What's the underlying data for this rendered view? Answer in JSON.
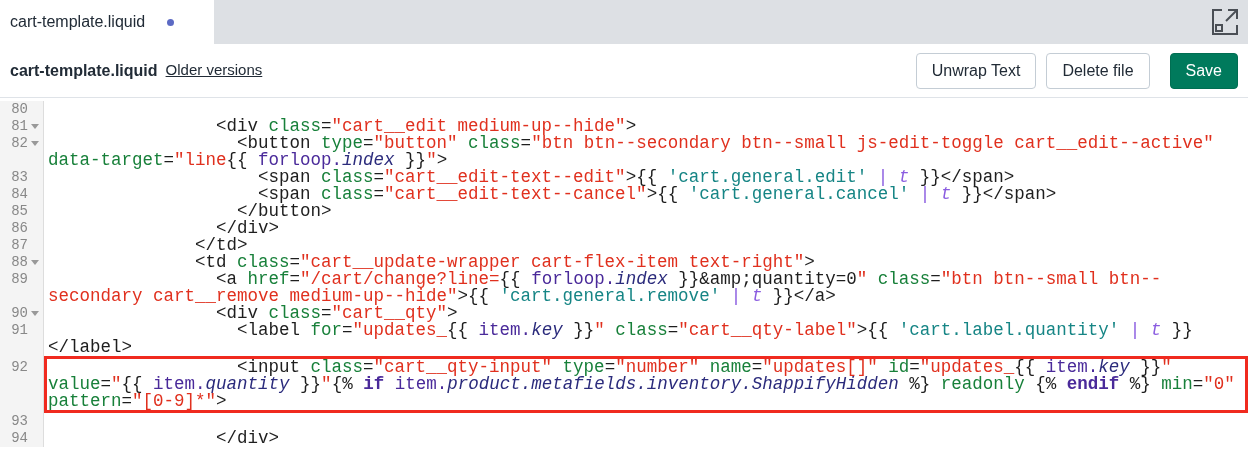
{
  "tab": {
    "label": "cart-template.liquid",
    "unsaved": true
  },
  "header": {
    "title": "cart-template.liquid",
    "link": "Older versions",
    "buttons": [
      {
        "label": "Unwrap Text",
        "kind": "secondary"
      },
      {
        "label": "Delete file",
        "kind": "secondary"
      },
      {
        "label": "Save",
        "kind": "primary"
      }
    ]
  },
  "lines": [
    {
      "number": "80",
      "foldable": false,
      "highlighted": false
    },
    {
      "number": "81",
      "foldable": true,
      "highlighted": false,
      "rows": [
        {
          "segments": [
            {
              "kind": "plain",
              "text": "                <div"
            },
            {
              "kind": "attr",
              "text": " class"
            },
            {
              "kind": "plain",
              "text": "="
            },
            {
              "kind": "string",
              "text": "\"cart__edit medium-up--hide\""
            },
            {
              "kind": "plain",
              "text": ">"
            }
          ]
        }
      ]
    },
    {
      "number": "82",
      "foldable": true,
      "highlighted": false,
      "rows": [
        {
          "segments": [
            {
              "kind": "plain",
              "text": "                  <button"
            },
            {
              "kind": "attr",
              "text": " type"
            },
            {
              "kind": "plain",
              "text": "="
            },
            {
              "kind": "string",
              "text": "\"button\""
            },
            {
              "kind": "attr",
              "text": " class"
            },
            {
              "kind": "plain",
              "text": "="
            },
            {
              "kind": "string",
              "text": "\"btn btn--secondary btn--small js-edit-toggle cart__edit--active\""
            }
          ]
        },
        {
          "segments": [
            {
              "kind": "attr",
              "text": "data-target"
            },
            {
              "kind": "plain",
              "text": "="
            },
            {
              "kind": "string",
              "text": "\"line"
            },
            {
              "kind": "plain",
              "text": "{{ "
            },
            {
              "kind": "var",
              "text": "forloop."
            },
            {
              "kind": "prop",
              "text": "index"
            },
            {
              "kind": "plain",
              "text": " }}"
            },
            {
              "kind": "string",
              "text": "\""
            },
            {
              "kind": "plain",
              "text": ">"
            }
          ]
        }
      ]
    },
    {
      "number": "83",
      "foldable": false,
      "highlighted": false,
      "rows": [
        {
          "segments": [
            {
              "kind": "plain",
              "text": "                    <span"
            },
            {
              "kind": "attr",
              "text": " class"
            },
            {
              "kind": "plain",
              "text": "="
            },
            {
              "kind": "string",
              "text": "\"cart__edit-text--edit\""
            },
            {
              "kind": "plain",
              "text": ">{{ "
            },
            {
              "kind": "lstring",
              "text": "'cart.general.edit'"
            },
            {
              "kind": "filter",
              "text": " | t"
            },
            {
              "kind": "plain",
              "text": " }}</span>"
            }
          ]
        }
      ]
    },
    {
      "number": "84",
      "foldable": false,
      "highlighted": false,
      "rows": [
        {
          "segments": [
            {
              "kind": "plain",
              "text": "                    <span"
            },
            {
              "kind": "attr",
              "text": " class"
            },
            {
              "kind": "plain",
              "text": "="
            },
            {
              "kind": "string",
              "text": "\"cart__edit-text--cancel\""
            },
            {
              "kind": "plain",
              "text": ">{{ "
            },
            {
              "kind": "lstring",
              "text": "'cart.general.cancel'"
            },
            {
              "kind": "filter",
              "text": " | t"
            },
            {
              "kind": "plain",
              "text": " }}</span>"
            }
          ]
        }
      ]
    },
    {
      "number": "85",
      "foldable": false,
      "highlighted": false,
      "rows": [
        {
          "segments": [
            {
              "kind": "plain",
              "text": "                  </button>"
            }
          ]
        }
      ]
    },
    {
      "number": "86",
      "foldable": false,
      "highlighted": false,
      "rows": [
        {
          "segments": [
            {
              "kind": "plain",
              "text": "                </div>"
            }
          ]
        }
      ]
    },
    {
      "number": "87",
      "foldable": false,
      "highlighted": false,
      "rows": [
        {
          "segments": [
            {
              "kind": "plain",
              "text": "              </td>"
            }
          ]
        }
      ]
    },
    {
      "number": "88",
      "foldable": true,
      "highlighted": false,
      "rows": [
        {
          "segments": [
            {
              "kind": "plain",
              "text": "              <td"
            },
            {
              "kind": "attr",
              "text": " class"
            },
            {
              "kind": "plain",
              "text": "="
            },
            {
              "kind": "string",
              "text": "\"cart__update-wrapper cart-flex-item text-right\""
            },
            {
              "kind": "plain",
              "text": ">"
            }
          ]
        }
      ]
    },
    {
      "number": "89",
      "foldable": false,
      "highlighted": false,
      "rows": [
        {
          "segments": [
            {
              "kind": "plain",
              "text": "                <a"
            },
            {
              "kind": "attr",
              "text": " href"
            },
            {
              "kind": "plain",
              "text": "="
            },
            {
              "kind": "string",
              "text": "\"/cart/change?line="
            },
            {
              "kind": "plain",
              "text": "{{ "
            },
            {
              "kind": "var",
              "text": "forloop."
            },
            {
              "kind": "prop",
              "text": "index"
            },
            {
              "kind": "plain",
              "text": " }}&amp;quantity=0"
            },
            {
              "kind": "string",
              "text": "\""
            },
            {
              "kind": "attr",
              "text": " class"
            },
            {
              "kind": "plain",
              "text": "="
            },
            {
              "kind": "string",
              "text": "\"btn btn--small btn--"
            }
          ]
        },
        {
          "segments": [
            {
              "kind": "string",
              "text": "secondary cart__remove medium-up--hide\""
            },
            {
              "kind": "plain",
              "text": ">{{ "
            },
            {
              "kind": "lstring",
              "text": "'cart.general.remove'"
            },
            {
              "kind": "filter",
              "text": " | t"
            },
            {
              "kind": "plain",
              "text": " }}</a>"
            }
          ]
        }
      ]
    },
    {
      "number": "90",
      "foldable": true,
      "highlighted": false,
      "rows": [
        {
          "segments": [
            {
              "kind": "plain",
              "text": "                <div"
            },
            {
              "kind": "attr",
              "text": " class"
            },
            {
              "kind": "plain",
              "text": "="
            },
            {
              "kind": "string",
              "text": "\"cart__qty\""
            },
            {
              "kind": "plain",
              "text": ">"
            }
          ]
        }
      ]
    },
    {
      "number": "91",
      "foldable": false,
      "highlighted": false,
      "rows": [
        {
          "segments": [
            {
              "kind": "plain",
              "text": "                  <label"
            },
            {
              "kind": "attr",
              "text": " for"
            },
            {
              "kind": "plain",
              "text": "="
            },
            {
              "kind": "string",
              "text": "\"updates_"
            },
            {
              "kind": "plain",
              "text": "{{ "
            },
            {
              "kind": "var",
              "text": "item."
            },
            {
              "kind": "prop",
              "text": "key"
            },
            {
              "kind": "plain",
              "text": " }}"
            },
            {
              "kind": "string",
              "text": "\""
            },
            {
              "kind": "attr",
              "text": " class"
            },
            {
              "kind": "plain",
              "text": "="
            },
            {
              "kind": "string",
              "text": "\"cart__qty-label\""
            },
            {
              "kind": "plain",
              "text": ">{{ "
            },
            {
              "kind": "lstring",
              "text": "'cart.label.quantity'"
            },
            {
              "kind": "filter",
              "text": " | t"
            },
            {
              "kind": "plain",
              "text": " }}"
            }
          ]
        },
        {
          "segments": [
            {
              "kind": "plain",
              "text": "</label>"
            }
          ]
        }
      ]
    },
    {
      "number": "92",
      "foldable": false,
      "highlighted": true,
      "rows": [
        {
          "segments": [
            {
              "kind": "plain",
              "text": "                  <input"
            },
            {
              "kind": "attr",
              "text": " class"
            },
            {
              "kind": "plain",
              "text": "="
            },
            {
              "kind": "string",
              "text": "\"cart__qty-input\""
            },
            {
              "kind": "attr",
              "text": " type"
            },
            {
              "kind": "plain",
              "text": "="
            },
            {
              "kind": "string",
              "text": "\"number\""
            },
            {
              "kind": "attr",
              "text": " name"
            },
            {
              "kind": "plain",
              "text": "="
            },
            {
              "kind": "string",
              "text": "\"updates[]\""
            },
            {
              "kind": "attr",
              "text": " id"
            },
            {
              "kind": "plain",
              "text": "="
            },
            {
              "kind": "string",
              "text": "\"updates_"
            },
            {
              "kind": "plain",
              "text": "{{ "
            },
            {
              "kind": "var",
              "text": "item."
            },
            {
              "kind": "prop",
              "text": "key"
            },
            {
              "kind": "plain",
              "text": " }}"
            },
            {
              "kind": "string",
              "text": "\""
            }
          ]
        },
        {
          "segments": [
            {
              "kind": "attr",
              "text": "value"
            },
            {
              "kind": "plain",
              "text": "="
            },
            {
              "kind": "string",
              "text": "\""
            },
            {
              "kind": "plain",
              "text": "{{ "
            },
            {
              "kind": "var",
              "text": "item."
            },
            {
              "kind": "prop",
              "text": "quantity"
            },
            {
              "kind": "plain",
              "text": " }}"
            },
            {
              "kind": "string",
              "text": "\""
            },
            {
              "kind": "plain",
              "text": "{% "
            },
            {
              "kind": "keyword",
              "text": "if"
            },
            {
              "kind": "var",
              "text": " item."
            },
            {
              "kind": "prop",
              "text": "product.metafields.inventory.ShappifyHidden"
            },
            {
              "kind": "plain",
              "text": " %} "
            },
            {
              "kind": "attr",
              "text": "readonly"
            },
            {
              "kind": "plain",
              "text": " {% "
            },
            {
              "kind": "keyword",
              "text": "endif"
            },
            {
              "kind": "plain",
              "text": " %} "
            },
            {
              "kind": "attr",
              "text": "min"
            },
            {
              "kind": "plain",
              "text": "="
            },
            {
              "kind": "string",
              "text": "\"0\""
            }
          ]
        },
        {
          "segments": [
            {
              "kind": "attr",
              "text": "pattern"
            },
            {
              "kind": "plain",
              "text": "="
            },
            {
              "kind": "string",
              "text": "\"[0-9]*\""
            },
            {
              "kind": "plain",
              "text": ">"
            }
          ]
        }
      ]
    },
    {
      "number": "93",
      "foldable": false,
      "highlighted": false
    },
    {
      "number": "94",
      "foldable": false,
      "highlighted": false,
      "rows": [
        {
          "segments": [
            {
              "kind": "plain",
              "text": "                </div>"
            }
          ]
        }
      ]
    }
  ]
}
